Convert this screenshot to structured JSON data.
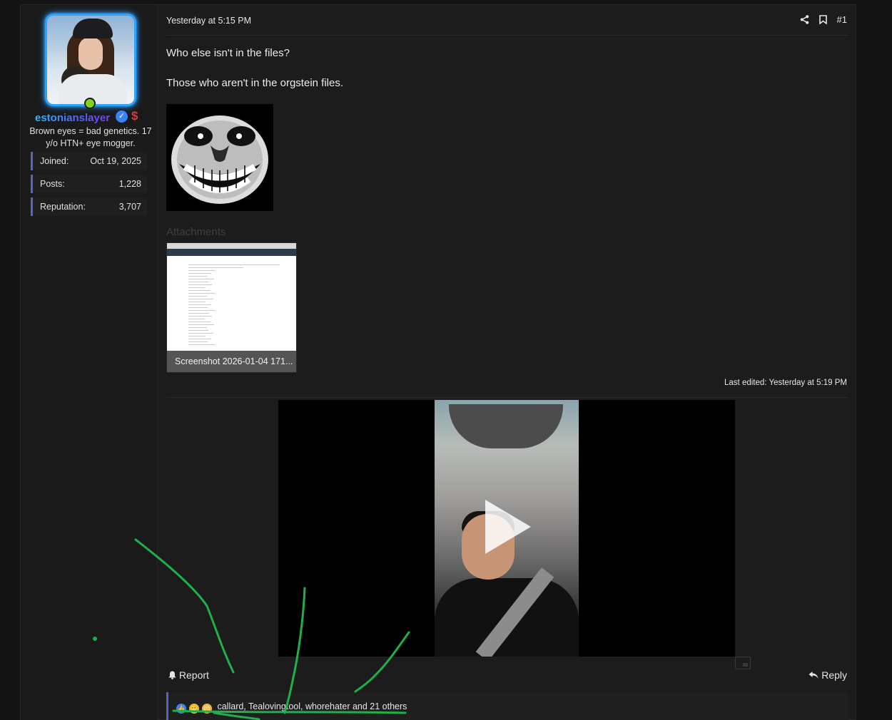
{
  "user": {
    "username": "estonianslayer",
    "verified_icon": "✓",
    "badge_icon": "$",
    "title": "Brown eyes = bad genetics. 17 y/o HTN+ eye mogger.",
    "stats": [
      {
        "label": "Joined:",
        "value": "Oct 19, 2025"
      },
      {
        "label": "Posts:",
        "value": "1,228"
      },
      {
        "label": "Reputation:",
        "value": "3,707"
      }
    ]
  },
  "post": {
    "date": "Yesterday at 5:15 PM",
    "number": "#1",
    "paragraphs": [
      "Who else isn't in the files?",
      "Those who aren't in the orgstein files."
    ],
    "attachments_title": "Attachments",
    "attachment_caption": "Screenshot 2026-01-04 171...",
    "last_edited": "Last edited: Yesterday at 5:19 PM"
  },
  "footer": {
    "report_label": "Report",
    "reply_label": "Reply",
    "reactions_text": "callard, Tealovingtool, whorehater and 21 others"
  },
  "colors": {
    "accent": "#5b62c9",
    "online": "#7ed321",
    "annotation": "#1fb04a"
  }
}
